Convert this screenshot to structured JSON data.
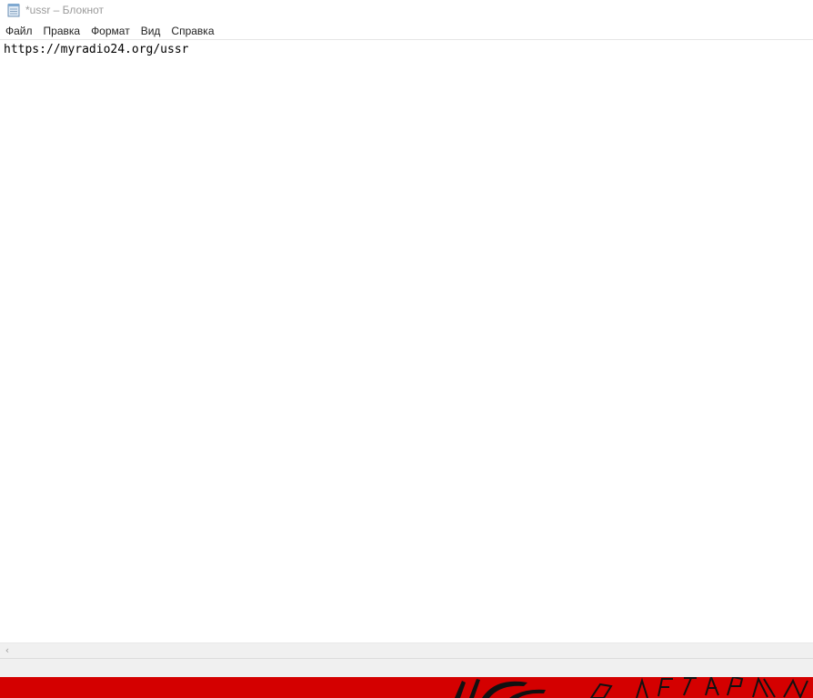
{
  "window": {
    "title": "*ussr – Блокнот",
    "icon": "notepad-icon"
  },
  "menu": {
    "items": [
      {
        "label": "Файл"
      },
      {
        "label": "Правка"
      },
      {
        "label": "Формат"
      },
      {
        "label": "Вид"
      },
      {
        "label": "Справка"
      }
    ]
  },
  "editor": {
    "text": "https://myradio24.org/ussr"
  },
  "scrollbar": {
    "left_arrow_icon": "chevron-left-icon"
  },
  "wallpaper": {
    "color": "#d40000"
  }
}
